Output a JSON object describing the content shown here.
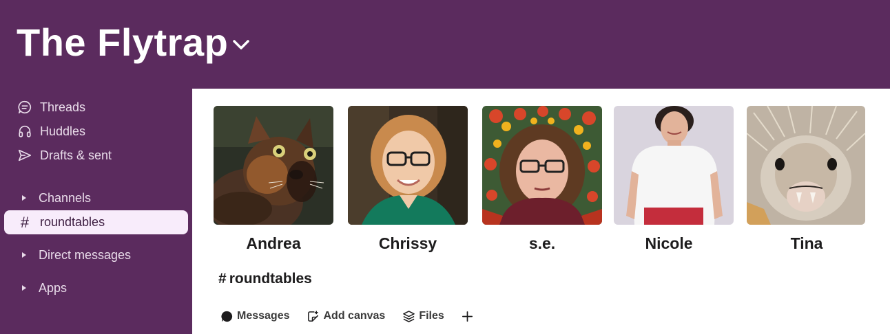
{
  "workspace": {
    "name": "The Flytrap"
  },
  "sidebar": {
    "items": [
      {
        "label": "Threads",
        "icon": "threads-icon"
      },
      {
        "label": "Huddles",
        "icon": "headphones-icon"
      },
      {
        "label": "Drafts & sent",
        "icon": "send-icon"
      }
    ],
    "sections": [
      {
        "label": "Channels"
      },
      {
        "label": "Direct messages"
      },
      {
        "label": "Apps"
      }
    ],
    "active_channel": {
      "hash": "#",
      "label": "roundtables"
    }
  },
  "members": [
    {
      "name": "Andrea"
    },
    {
      "name": "Chrissy"
    },
    {
      "name": "s.e."
    },
    {
      "name": "Nicole"
    },
    {
      "name": "Tina"
    }
  ],
  "channel": {
    "hash": "#",
    "name": "roundtables"
  },
  "tabs": [
    {
      "label": "Messages",
      "icon": "message-bubble-icon"
    },
    {
      "label": "Add canvas",
      "icon": "canvas-icon"
    },
    {
      "label": "Files",
      "icon": "files-stack-icon"
    }
  ],
  "colors": {
    "aubergine": "#5b2b5e",
    "active_bg": "#f8ecfb"
  }
}
